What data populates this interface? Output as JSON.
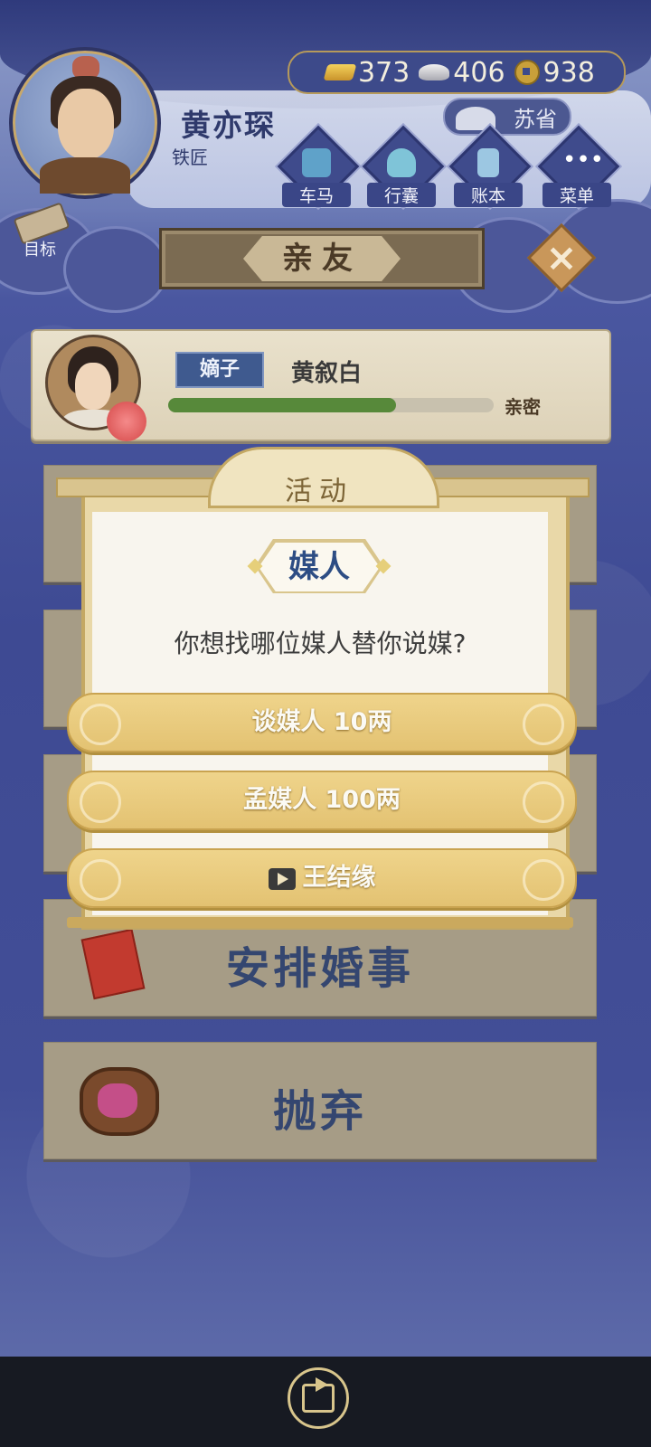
{
  "header": {
    "player_name": "黄亦琛",
    "player_job": "铁匠",
    "location": "苏省",
    "goal_label": "目标",
    "currency": [
      {
        "icon": "gold-ingot-icon",
        "value": "373"
      },
      {
        "icon": "silver-ingot-icon",
        "value": "406"
      },
      {
        "icon": "copper-coin-icon",
        "value": "938"
      }
    ],
    "menu": [
      {
        "label": "车马",
        "icon": "carriage-icon",
        "color": "#5fa2c9"
      },
      {
        "label": "行囊",
        "icon": "bag-icon",
        "color": "#7fc4d8"
      },
      {
        "label": "账本",
        "icon": "ledger-icon",
        "color": "#9cc7e2"
      },
      {
        "label": "菜单",
        "icon": "more-icon",
        "color": "#ffffff"
      }
    ]
  },
  "page": {
    "title": "亲友"
  },
  "child": {
    "rank": "嫡子",
    "name": "黄叙白",
    "relation_label": "亲密",
    "intimacy_fraction": 0.7
  },
  "actions": {
    "arrange_marriage": "安排婚事",
    "abandon": "抛弃"
  },
  "dialog": {
    "header": "活动",
    "subtitle": "媒人",
    "question": "你想找哪位媒人替你说媒?",
    "options": [
      {
        "label": "谈媒人 10两"
      },
      {
        "label": "孟媒人 100两"
      },
      {
        "label": "王结缘",
        "icon": "video-play-icon"
      }
    ]
  },
  "colors": {
    "accent_gold": "#e3c272",
    "title_blue": "#2d4d84",
    "bar_green": "#57893a"
  }
}
